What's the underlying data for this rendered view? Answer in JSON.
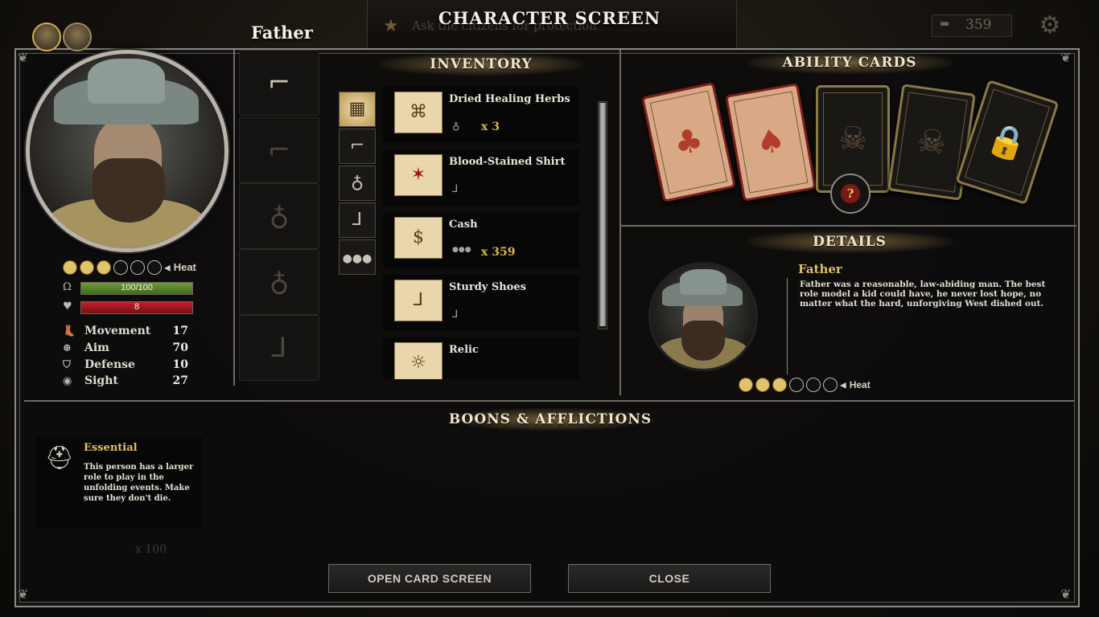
{
  "header": {
    "title": "CHARACTER SCREEN",
    "character_name": "Father",
    "quest_text": "Ask the citizens for protection",
    "money": "359"
  },
  "character": {
    "heat_label": "Heat",
    "heat_level": 3,
    "heat_max": 6,
    "health_text": "100/100",
    "health_fraction": 1.0,
    "heat_value": "8",
    "heat_fraction": 1.0,
    "stats": [
      {
        "icon": "boot-icon",
        "label": "Movement",
        "value": "17"
      },
      {
        "icon": "crosshair-icon",
        "label": "Aim",
        "value": "70"
      },
      {
        "icon": "shield-icon",
        "label": "Defense",
        "value": "10"
      },
      {
        "icon": "eye-icon",
        "label": "Sight",
        "value": "27"
      }
    ]
  },
  "equipment": [
    {
      "icon": "revolver-icon",
      "filled": true
    },
    {
      "icon": "pistol-icon",
      "filled": false
    },
    {
      "icon": "flask-icon",
      "filled": false
    },
    {
      "icon": "flask-icon",
      "filled": false
    },
    {
      "icon": "boots-icon",
      "filled": false
    }
  ],
  "inventory": {
    "title": "INVENTORY",
    "filters": [
      "all-items-icon",
      "revolver-icon",
      "flask-icon",
      "boot-icon",
      "more-icon"
    ],
    "items": [
      {
        "name": "Dried Healing Herbs",
        "icon": "flask-icon",
        "qty": "x 3"
      },
      {
        "name": "Blood-Stained Shirt",
        "icon": "boot-icon",
        "qty": ""
      },
      {
        "name": "Cash",
        "icon": "more-icon",
        "qty": "x 359"
      },
      {
        "name": "Sturdy Shoes",
        "icon": "boot-icon",
        "qty": ""
      },
      {
        "name": "Relic",
        "icon": "boot-icon",
        "qty": ""
      }
    ]
  },
  "ability_cards": {
    "title": "ABILITY CARDS",
    "help": "?"
  },
  "details": {
    "title": "DETAILS",
    "name": "Father",
    "description": "Father was a reasonable, law-abiding man. The best role model a kid could have, he never lost hope, no matter what the hard, unforgiving West dished out.",
    "heat_label": "Heat"
  },
  "boons": {
    "title": "BOONS & AFFLICTIONS",
    "items": [
      {
        "title": "Essential",
        "description": "This person has a larger role to play in the unfolding events. Make sure they don't die."
      }
    ],
    "ghost": "x 100"
  },
  "buttons": {
    "open_card_screen": "OPEN CARD SCREEN",
    "close": "CLOSE"
  },
  "colors": {
    "accent_gold": "#e3c06a",
    "health_green": "#5f8f2c",
    "heat_red": "#b51d26"
  }
}
